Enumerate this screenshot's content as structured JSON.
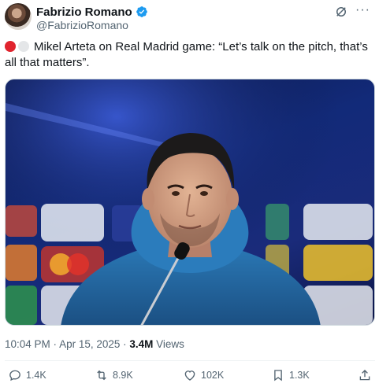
{
  "author": {
    "name": "Fabrizio Romano",
    "handle": "@FabrizioRomano",
    "verified": true
  },
  "icons": {
    "verified": "verified-badge-icon",
    "grok": "grok-icon",
    "more": "more-icon",
    "reply": "reply-icon",
    "retweet": "retweet-icon",
    "like": "like-icon",
    "bookmark": "bookmark-icon",
    "share": "share-icon"
  },
  "tweet": {
    "text": "Mikel Arteta on Real Madrid game: “Let’s talk on the pitch, that’s all that matters”.",
    "flag_colors": [
      "#e0242e",
      "#e4e6e8"
    ]
  },
  "media": {
    "alt": "Mikel Arteta at a press conference"
  },
  "meta": {
    "time": "10:04 PM",
    "sep1": " · ",
    "date": "Apr 15, 2025",
    "sep2": " · ",
    "views_count": "3.4M",
    "views_label": " Views"
  },
  "actions": {
    "replies": "1.4K",
    "reposts": "8.9K",
    "likes": "102K",
    "bookmarks": "1.3K"
  },
  "colors": {
    "text": "#0f1419",
    "secondary": "#536471",
    "verified": "#1d9bf0",
    "border": "#cfd9de"
  }
}
